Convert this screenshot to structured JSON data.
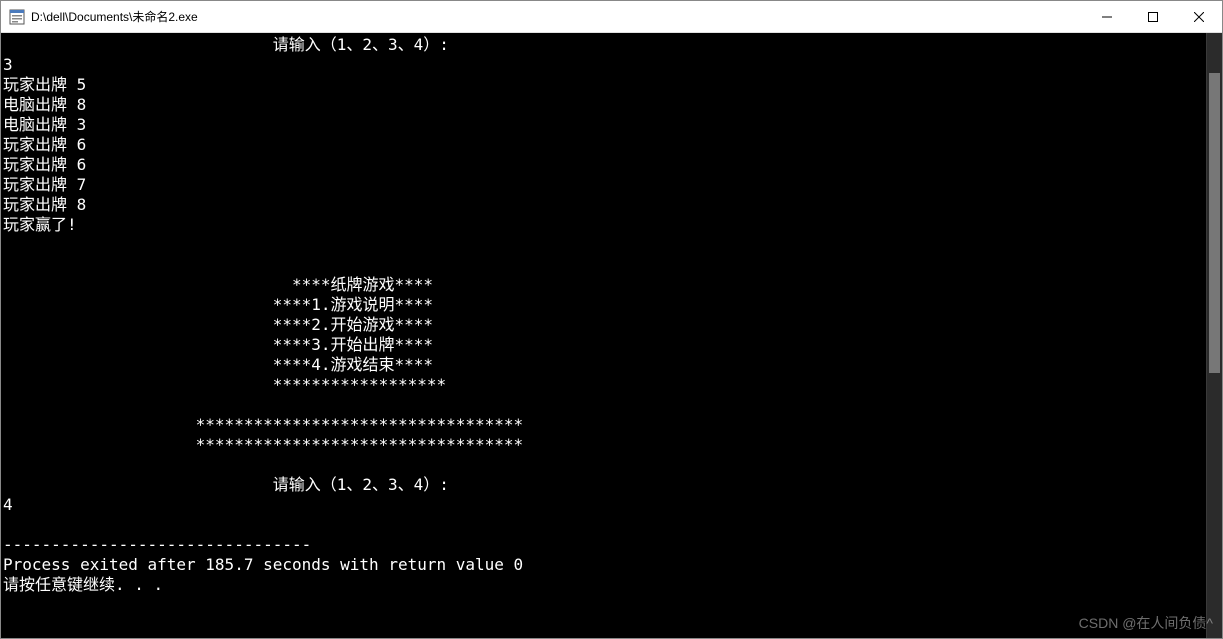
{
  "window": {
    "title": "D:\\dell\\Documents\\未命名2.exe"
  },
  "console": {
    "prompt1_indent": "                            ",
    "prompt1": "请输入（1、2、3、4）:",
    "input1": "3",
    "plays": [
      "玩家出牌 5",
      "电脑出牌 8",
      "电脑出牌 3",
      "玩家出牌 6",
      "玩家出牌 6",
      "玩家出牌 7",
      "玩家出牌 8"
    ],
    "result": "玩家赢了!",
    "blank": "",
    "menu_indent1": "                              ",
    "menu_indent2": "                            ",
    "menu_title": "****纸牌游戏****",
    "menu1": "****1.游戏说明****",
    "menu2": "****2.开始游戏****",
    "menu3": "****3.开始出牌****",
    "menu4": "****4.游戏结束****",
    "menu_sep": "******************",
    "stars_indent": "                    ",
    "stars_row": "**********************************",
    "prompt2_indent": "                            ",
    "prompt2": "请输入（1、2、3、4）:",
    "input2": "4",
    "dashes": "--------------------------------",
    "exit_msg": "Process exited after 185.7 seconds with return value 0",
    "continue_msg": "请按任意键继续. . ."
  },
  "watermark": "CSDN @在人间负债^"
}
